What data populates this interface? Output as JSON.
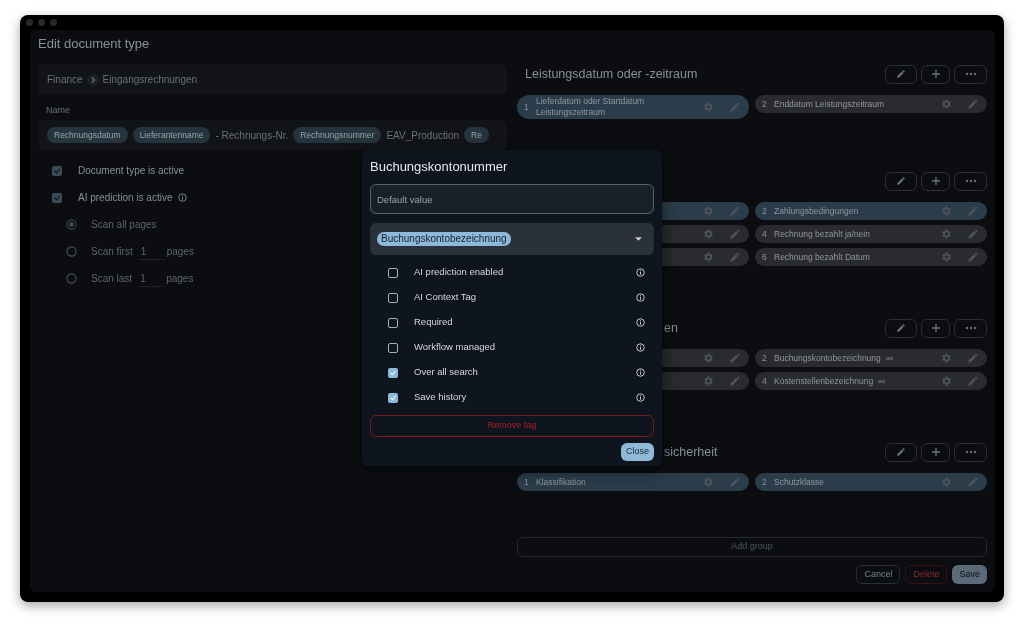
{
  "window": {
    "title": "Edit document type"
  },
  "breadcrumb": [
    "Finance",
    "Eingangsrechnungen"
  ],
  "name": {
    "label": "Name",
    "parts": [
      {
        "kind": "chip",
        "text": "Rechnungsdatum"
      },
      {
        "kind": "chip",
        "text": "Lieferantenname"
      },
      {
        "kind": "text",
        "text": "- Rechnungs-Nr."
      },
      {
        "kind": "chip",
        "text": "Rechnungsnummer"
      },
      {
        "kind": "text",
        "text": "EAV_Production"
      },
      {
        "kind": "chip",
        "text": "Re"
      }
    ]
  },
  "settings": [
    {
      "label": "Document type is active",
      "checked": true,
      "info": false
    },
    {
      "label": "AI prediction is active",
      "checked": true,
      "info": true
    }
  ],
  "scan": [
    {
      "label": "Scan all pages",
      "selected": true
    },
    {
      "label": "Scan first",
      "value": "1",
      "suffix": "pages",
      "selected": false
    },
    {
      "label": "Scan last",
      "value": "1",
      "suffix": "pages",
      "selected": false
    }
  ],
  "groups": [
    {
      "title": "Leistungsdatum oder -zeitraum",
      "title_cut": false,
      "fields": [
        {
          "number": "1",
          "label": "Lieferdatum oder Startdatum Leistungszeitraum",
          "linked": false,
          "color": "#2b3d4a"
        },
        {
          "number": "2",
          "label": "Enddatum Leistungszeitraum",
          "linked": false,
          "color": "#2a2b2e"
        }
      ]
    },
    {
      "fields": [
        {
          "color": "#2b3d4a"
        },
        {
          "number": "2",
          "label": "Zahlungsbedingungen",
          "linked": false,
          "color": "#2b3d4a"
        },
        {
          "color": "#2a2b2e"
        },
        {
          "number": "4",
          "label": "Rechnung bezahlt ja/nein",
          "linked": false,
          "color": "#2a2b2e"
        },
        {
          "color": "#2a2b2e"
        },
        {
          "number": "6",
          "label": "Rechnung bezahlt Datum",
          "linked": false,
          "color": "#2a2b2e"
        }
      ]
    },
    {
      "title": "en",
      "title_cut": true,
      "fields": [
        {
          "color": "#2a2b2e"
        },
        {
          "number": "2",
          "label": "Buchungskontobezeichnung",
          "linked": true,
          "color": "#2a2b2e"
        },
        {
          "color": "#2a2b2e"
        },
        {
          "number": "4",
          "label": "Kostenstellenbezeichnung",
          "linked": true,
          "color": "#2a2b2e"
        }
      ]
    },
    {
      "title": "sicherheit",
      "title_cut": true,
      "fields": [
        {
          "number": "1",
          "label": "Klassifikation",
          "linked": false,
          "color": "#2b3d4a"
        },
        {
          "number": "2",
          "label": "Schutzklasse",
          "linked": false,
          "color": "#2b3d4a"
        }
      ]
    }
  ],
  "add_group": "Add group",
  "actions": [
    {
      "label": "Cancel",
      "kind": "outline"
    },
    {
      "label": "Delete",
      "kind": "danger"
    },
    {
      "label": "Save",
      "kind": "primary"
    }
  ],
  "modal": {
    "title": "Buchungskontonummer",
    "default_placeholder": "Default value",
    "tag": "Buchungskontobezeichnung",
    "options": [
      {
        "label": "AI prediction enabled",
        "checked": false
      },
      {
        "label": "AI Context Tag",
        "checked": false
      },
      {
        "label": "Required",
        "checked": false
      },
      {
        "label": "Workflow managed",
        "checked": false
      },
      {
        "label": "Over all search",
        "checked": true
      },
      {
        "label": "Save history",
        "checked": true
      }
    ],
    "remove": "Remove tag",
    "close": "Close"
  }
}
